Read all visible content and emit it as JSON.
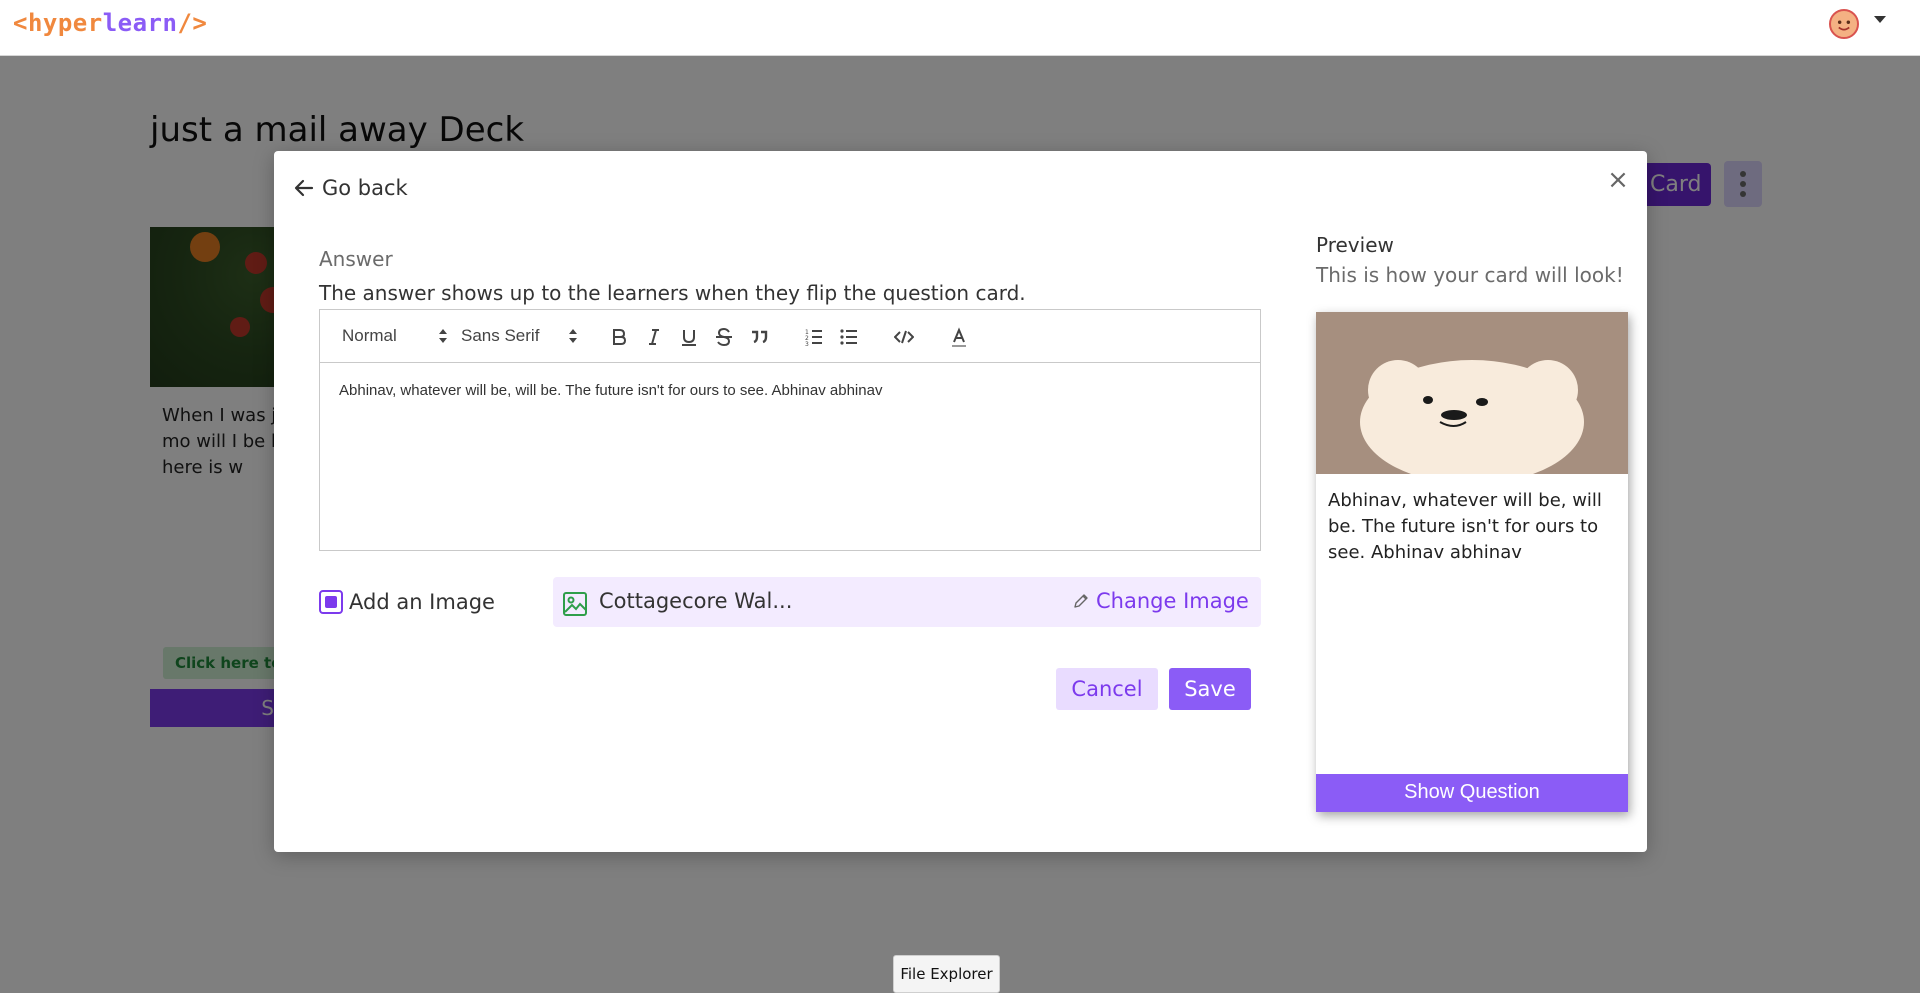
{
  "app": {
    "logo": {
      "open": "<",
      "hyper": "hyper",
      "learn": "learn",
      "close": "/>"
    }
  },
  "page": {
    "title": "just a mail away Deck",
    "add_card_label": "Card",
    "bg_card_text": "When I was ju asked my mo will I be hand and here is w",
    "bg_card_chip": "Click here to",
    "bg_card_footer": "Sho"
  },
  "modal": {
    "go_back": "Go back",
    "close": "×",
    "field_label": "Answer",
    "field_description": "The answer shows up to the learners when they flip the question card.",
    "toolbar": {
      "size_value": "Normal",
      "font_value": "Sans Serif"
    },
    "editor_text": "Abhinav, whatever will be, will be. The future isn't for ours to see. Abhinav abhinav",
    "add_image_label": "Add an Image",
    "add_image_checked": true,
    "image_name": "Cottagecore Wal...",
    "change_image_label": "Change Image",
    "cancel_label": "Cancel",
    "save_label": "Save",
    "preview": {
      "title": "Preview",
      "subtitle": "This is how your card will look!",
      "card_text": "Abhinav, whatever will be, will be. The future isn't for ours to see. Abhinav abhinav",
      "button_label": "Show Question"
    }
  },
  "taskbar": {
    "file_explorer": "File Explorer"
  },
  "colors": {
    "accent": "#8b5cf6",
    "accent_dark": "#6d28d9",
    "accent_light": "#e9dcff",
    "logo_orange": "#f0883e"
  }
}
